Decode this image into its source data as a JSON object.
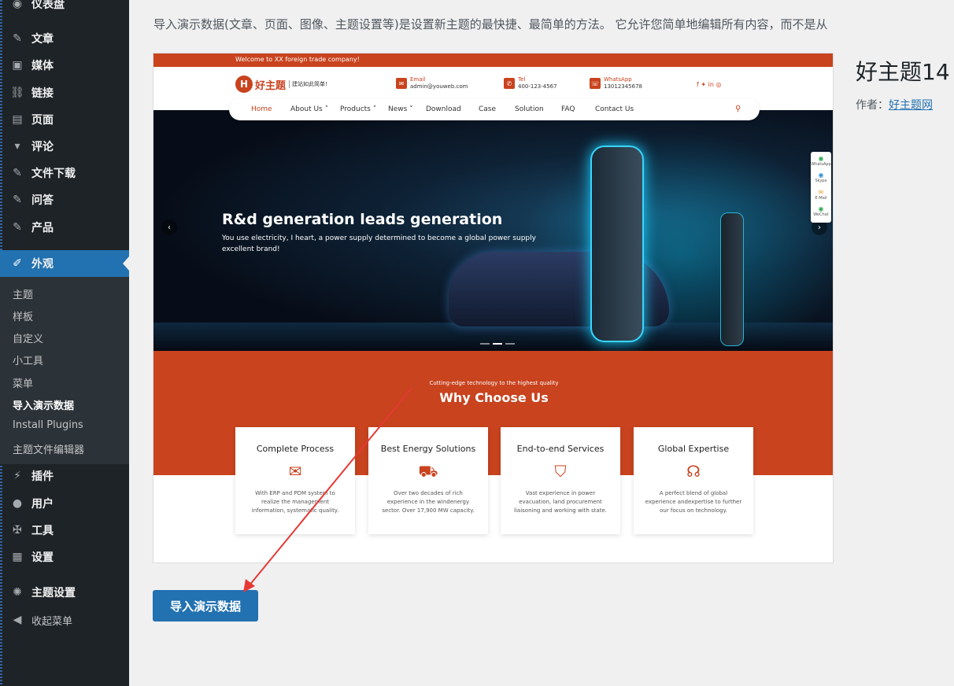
{
  "sidebar": {
    "items": [
      {
        "label": "仪表盘",
        "icon": "dashboard-icon",
        "glyph": "◉"
      },
      {
        "label": "文章",
        "icon": "pin-icon",
        "glyph": "✎"
      },
      {
        "label": "媒体",
        "icon": "media-icon",
        "glyph": "▣"
      },
      {
        "label": "链接",
        "icon": "link-icon",
        "glyph": "⛓"
      },
      {
        "label": "页面",
        "icon": "page-icon",
        "glyph": "▤"
      },
      {
        "label": "评论",
        "icon": "comment-icon",
        "glyph": "▾"
      },
      {
        "label": "文件下载",
        "icon": "pin-icon",
        "glyph": "✎"
      },
      {
        "label": "问答",
        "icon": "pin-icon",
        "glyph": "✎"
      },
      {
        "label": "产品",
        "icon": "pin-icon",
        "glyph": "✎"
      },
      {
        "label": "外观",
        "icon": "appearance-icon",
        "glyph": "✐"
      },
      {
        "label": "插件",
        "icon": "plugin-icon",
        "glyph": "⚡"
      },
      {
        "label": "用户",
        "icon": "user-icon",
        "glyph": "●"
      },
      {
        "label": "工具",
        "icon": "wrench-icon",
        "glyph": "✠"
      },
      {
        "label": "设置",
        "icon": "settings-icon",
        "glyph": "▦"
      },
      {
        "label": "主题设置",
        "icon": "gear-icon",
        "glyph": "✺"
      },
      {
        "label": "收起菜单",
        "icon": "collapse-icon",
        "glyph": "◀"
      }
    ],
    "submenu": [
      "主题",
      "样板",
      "自定义",
      "小工具",
      "菜单",
      "导入演示数据",
      "Install Plugins",
      "主题文件编辑器"
    ]
  },
  "intro_text": "导入演示数据(文章、页面、图像、主题设置等)是设置新主题的最快捷、最简单的方法。 它允许您简单地编辑所有内容，而不是从",
  "theme": {
    "name": "好主题14",
    "author_label": "作者：",
    "author_link": "好主题网"
  },
  "import_button": "导入演示数据",
  "preview": {
    "welcome": "Welcome to XX foreign trade company!",
    "logo_mark": "H",
    "logo_text": "好主题",
    "logo_slogan": "建站如此简单!",
    "email_label": "Email",
    "email": "admin@youweb.com",
    "tel_label": "Tel",
    "tel": "400-123-4567",
    "whatsapp_label": "WhatsApp",
    "whatsapp": "13012345678",
    "social": "f  ✦  in  ◎",
    "nav": [
      "Home",
      "About Us ˅",
      "Products ˅",
      "News ˅",
      "Download",
      "Case",
      "Solution",
      "FAQ",
      "Contact Us"
    ],
    "hero_title": "R&d generation leads generation",
    "hero_subtitle": "You use electricity, I heart, a power supply determined to become a global power supply excellent brand!",
    "float_bar": [
      "WhatsApp",
      "Skype",
      "E-Mail",
      "WeChat"
    ],
    "why_subtitle": "Cutting-edge technology to the highest quality",
    "why_title": "Why Choose Us",
    "cards": [
      {
        "title": "Complete Process",
        "icon": "✉",
        "desc": "With ERP and PDM system to realize the management information, systematic quality."
      },
      {
        "title": "Best Energy Solutions",
        "icon": "⛟",
        "desc": "Over two decades of rich experience in the windenergy sector. Over 17,900 MW capacity."
      },
      {
        "title": "End-to-end Services",
        "icon": "⛉",
        "desc": "Vast experience in power evacuation, land procurement liaisoning and working with state."
      },
      {
        "title": "Global Expertise",
        "icon": "☊",
        "desc": "A perfect blend of global experience andexpertise to further our focus on technology."
      }
    ]
  },
  "colors": {
    "sidebar": "#1d2327",
    "active": "#2271b1",
    "brand": "#c8431e",
    "arrow": "#e53935"
  }
}
